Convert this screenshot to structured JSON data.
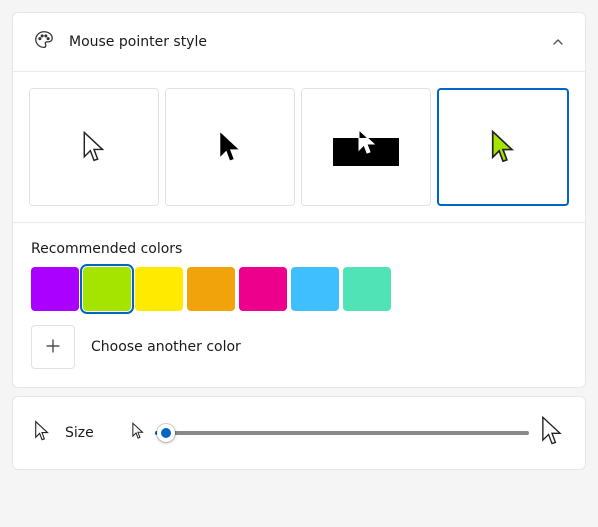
{
  "header": {
    "title": "Mouse pointer style"
  },
  "styles": {
    "options": [
      "white",
      "black",
      "inverted",
      "custom"
    ],
    "selected_index": 3,
    "custom_color": "#a4e400"
  },
  "recommended": {
    "label": "Recommended colors",
    "colors": [
      "#aa00ff",
      "#a4e400",
      "#ffea00",
      "#f0a30a",
      "#ec008c",
      "#40bfff",
      "#4fe3b6"
    ],
    "selected_index": 1,
    "choose_label": "Choose another color"
  },
  "size": {
    "label": "Size",
    "min": 1,
    "max": 15,
    "value": 1
  }
}
